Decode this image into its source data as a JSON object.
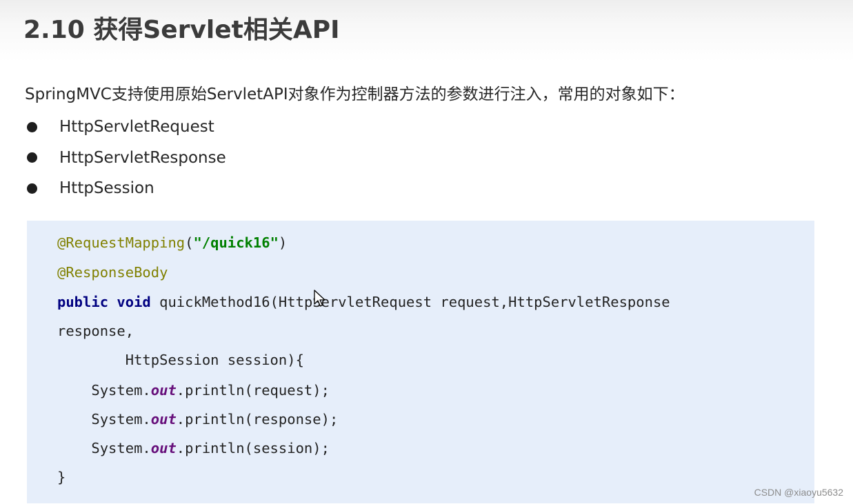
{
  "slide": {
    "title": "2.10 获得Servlet相关API",
    "intro": "SpringMVC支持使用原始ServletAPI对象作为控制器方法的参数进行注入，常用的对象如下：",
    "bullets": [
      "HttpServletRequest",
      "HttpServletResponse",
      "HttpSession"
    ]
  },
  "code": {
    "annotation1": "@RequestMapping",
    "paren_open": "(",
    "mapping_path": "\"/quick16\"",
    "paren_close": ")",
    "annotation2": "@ResponseBody",
    "kw_public": "public",
    "kw_void": "void",
    "line3_rest": " quickMethod16(HttpServletRequest request,HttpServletResponse",
    "line4": "response,",
    "line5": "        HttpSession session){",
    "print_prefix": "    System.",
    "print_static": "out",
    "print_lines": [
      ".println(request);",
      ".println(response);",
      ".println(session);"
    ],
    "closing_brace": "}"
  },
  "watermark": "CSDN @xiaoyu5632",
  "colors": {
    "code_background": "#e6eefa",
    "annotation": "#808000",
    "string": "#008000",
    "keyword": "#000080",
    "static_field": "#660e7a"
  },
  "icons": {
    "cursor": "mouse-pointer-icon"
  }
}
